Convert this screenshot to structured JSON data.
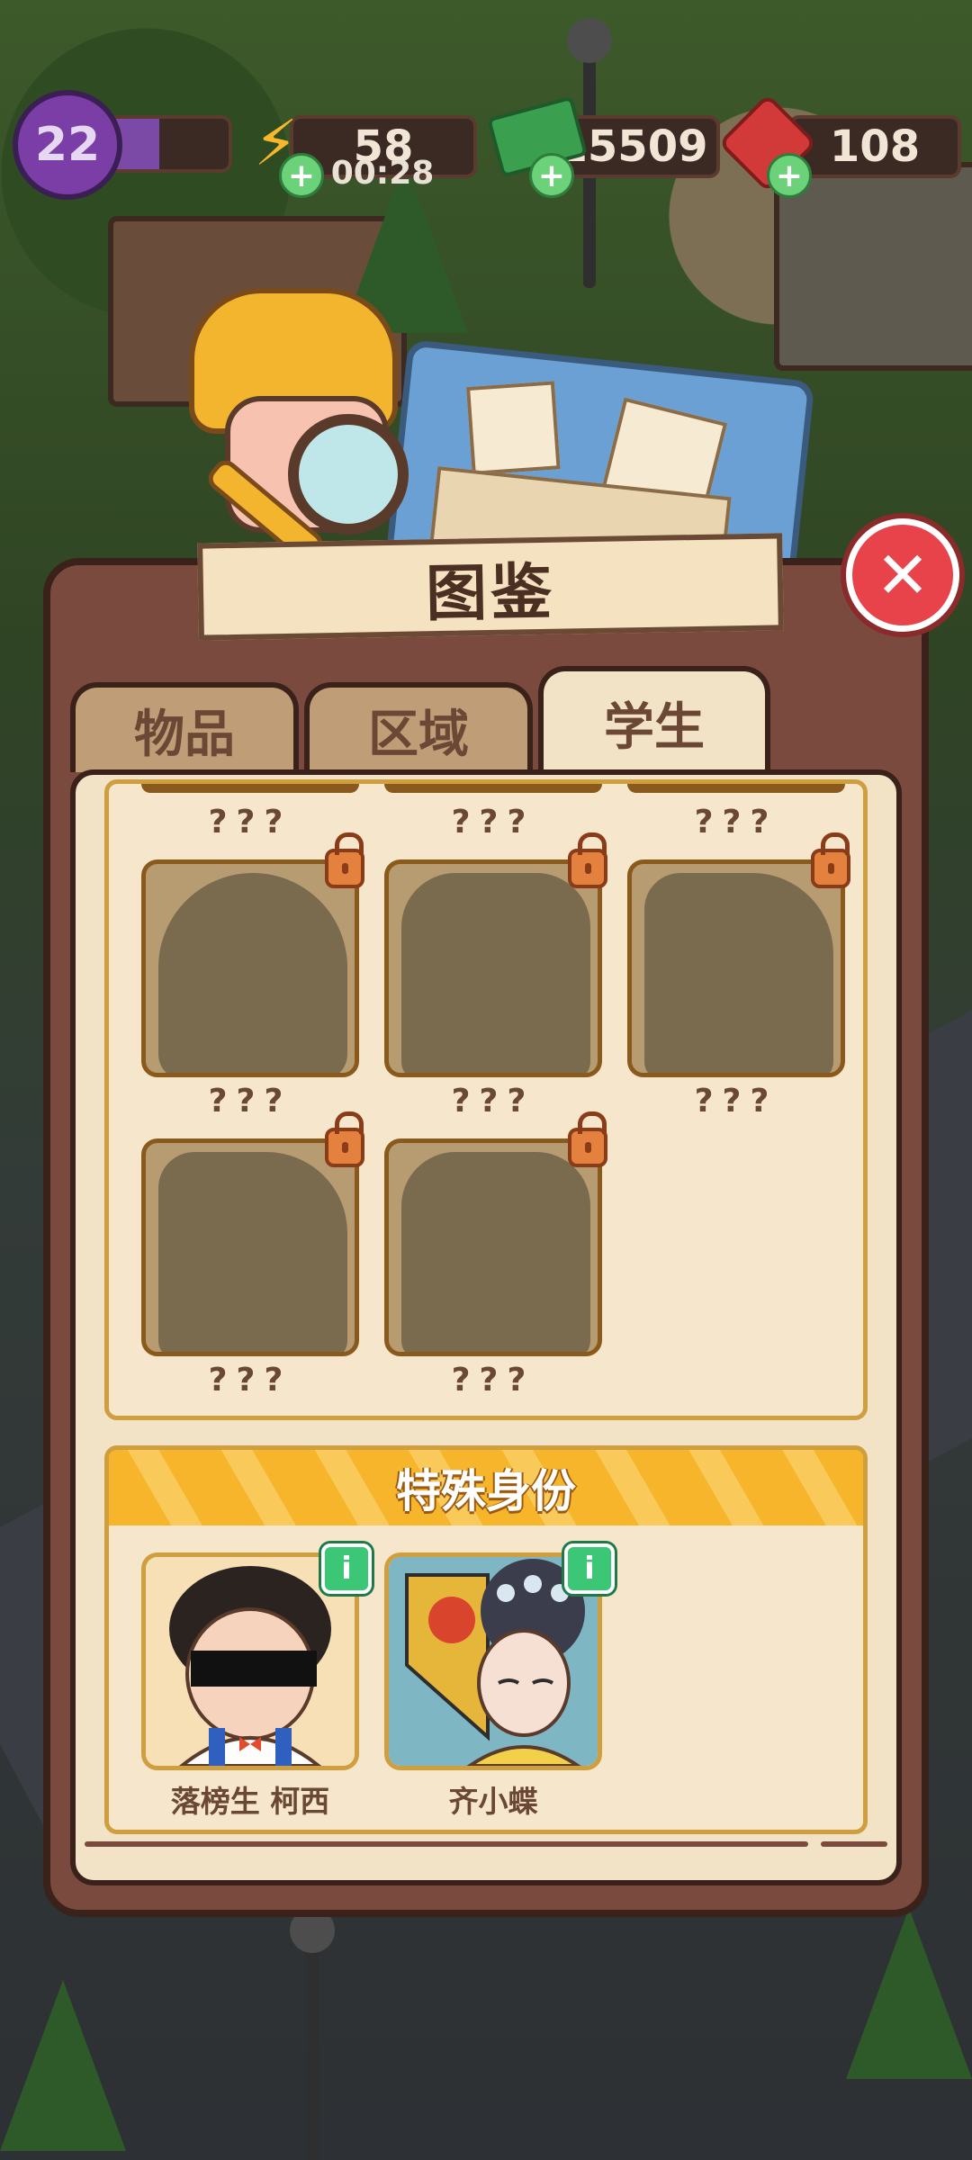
{
  "hud": {
    "level": "22",
    "level_progress": 0.45,
    "energy": "58",
    "energy_timer": "00:28",
    "cash": "15509",
    "gems": "108",
    "plus_label": "+"
  },
  "panel": {
    "title": "图鉴",
    "close_label": "✕"
  },
  "tabs": [
    {
      "label": "物品",
      "active": false
    },
    {
      "label": "区域",
      "active": false
    },
    {
      "label": "学生",
      "active": true
    }
  ],
  "locked_students": {
    "unknown_label": "???",
    "top_partial_row": [
      "???",
      "???",
      "???"
    ],
    "rows": [
      [
        "???",
        "???",
        "???"
      ],
      [
        "???",
        "???"
      ]
    ]
  },
  "special": {
    "header": "特殊身份",
    "info_label": "i",
    "students": [
      {
        "name": "落榜生 柯西"
      },
      {
        "name": "齐小蝶"
      }
    ]
  },
  "colors": {
    "panel": "#7b4a3e",
    "panel_inner": "#f3e3c6",
    "close": "#e8434a",
    "special_header": "#f6b52a"
  }
}
